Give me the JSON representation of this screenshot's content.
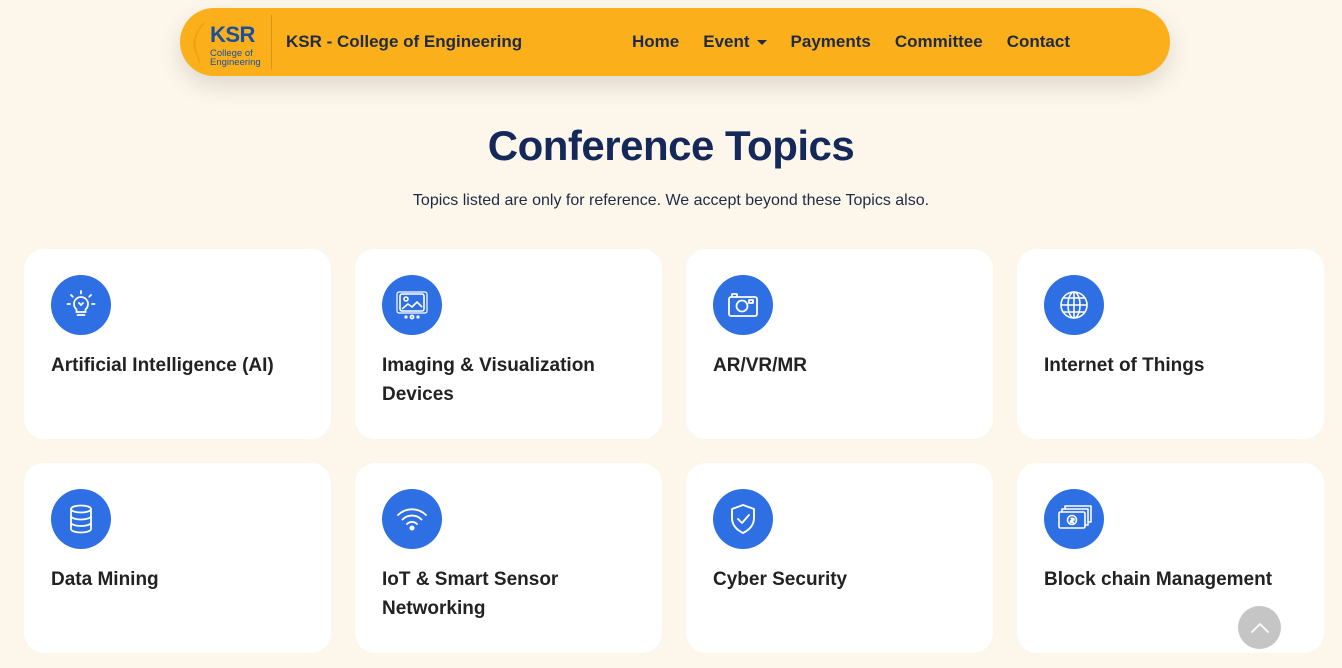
{
  "navbar": {
    "logo_text": "KSR",
    "logo_subtext": "College of Engineering",
    "brand_name": "KSR - College of Engineering",
    "links": [
      {
        "label": "Home",
        "icon": null
      },
      {
        "label": "Event",
        "icon": "caret-down-icon"
      },
      {
        "label": "Payments",
        "icon": null
      },
      {
        "label": "Committee",
        "icon": null
      },
      {
        "label": "Contact",
        "icon": null
      }
    ],
    "accent_color": "#fbb01b"
  },
  "header": {
    "title": "Conference Topics",
    "subtitle": "Topics listed are only for reference. We accept beyond these Topics also."
  },
  "topics": [
    {
      "label": "Artificial Intelligence (AI)",
      "icon": "lightbulb-icon"
    },
    {
      "label": "Imaging & Visualization Devices",
      "icon": "image-gallery-icon"
    },
    {
      "label": "AR/VR/MR",
      "icon": "camera-icon"
    },
    {
      "label": "Internet of Things",
      "icon": "globe-icon"
    },
    {
      "label": "Data Mining",
      "icon": "database-icon"
    },
    {
      "label": "IoT & Smart Sensor Networking",
      "icon": "wifi-icon"
    },
    {
      "label": "Cyber Security",
      "icon": "shield-check-icon"
    },
    {
      "label": "Block chain Management",
      "icon": "money-stack-icon"
    }
  ],
  "colors": {
    "background": "#fdf6ea",
    "icon_circle": "#2f6fe4",
    "title": "#14285a"
  },
  "back_to_top": {
    "icon": "chevron-up-icon"
  }
}
